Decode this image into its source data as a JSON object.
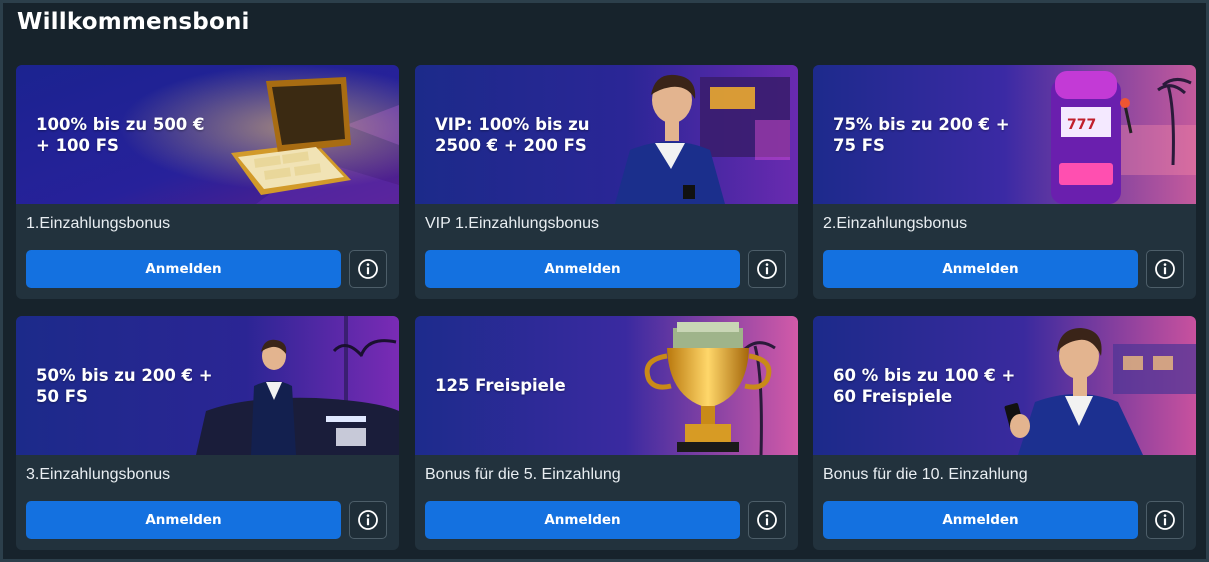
{
  "page": {
    "title": "Willkommensboni"
  },
  "offers": [
    {
      "headline": "100% bis zu 500 €\n+ 100 FS",
      "name": "1.Einzahlungsbonus",
      "cta_label": "Anmelden",
      "info_icon": "info-icon",
      "art": "briefcase-of-money"
    },
    {
      "headline": "VIP: 100% bis zu\n2500 € + 200 FS",
      "name": "VIP 1.Einzahlungsbonus",
      "cta_label": "Anmelden",
      "info_icon": "info-icon",
      "art": "vip-man-in-suit"
    },
    {
      "headline": "75% bis zu 200 € +\n75 FS",
      "name": "2.Einzahlungsbonus",
      "cta_label": "Anmelden",
      "info_icon": "info-icon",
      "art": "slot-machine"
    },
    {
      "headline": "50% bis zu 200 € +\n50 FS",
      "name": "3.Einzahlungsbonus",
      "cta_label": "Anmelden",
      "info_icon": "info-icon",
      "art": "man-and-luxury-car"
    },
    {
      "headline": "125 Freispiele",
      "name": "Bonus für die 5. Einzahlung",
      "cta_label": "Anmelden",
      "info_icon": "info-icon",
      "art": "golden-trophy"
    },
    {
      "headline": "60 % bis zu 100 € +\n60 Freispiele",
      "name": "Bonus für die 10. Einzahlung",
      "cta_label": "Anmelden",
      "info_icon": "info-icon",
      "art": "man-with-phone"
    }
  ],
  "colors": {
    "background": "#17232c",
    "card": "#22323d",
    "button": "#1471e0",
    "banner_blue": "#1c2a86",
    "banner_purple": "#7a2fb5"
  }
}
